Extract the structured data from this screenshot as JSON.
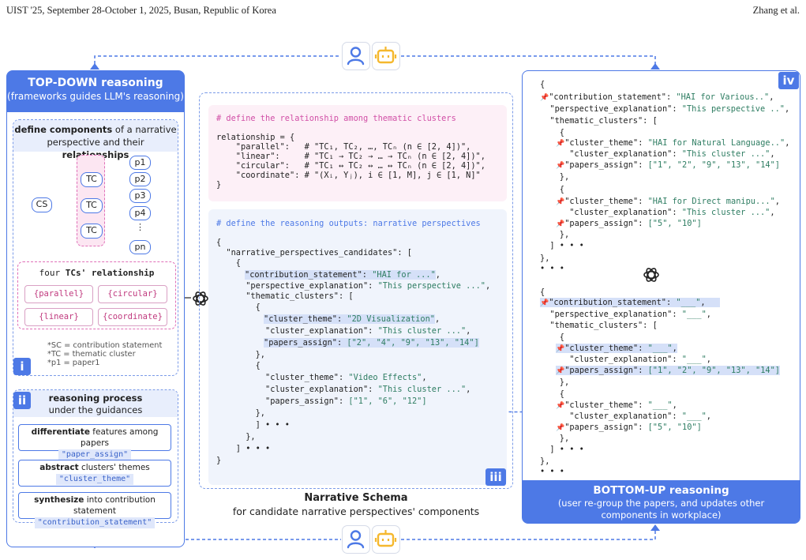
{
  "header": {
    "left": "UIST '25, September 28-October 1, 2025, Busan, Republic of Korea",
    "right": "Zhang et al."
  },
  "icons": {
    "user": "user-icon",
    "bot": "robot-icon",
    "llm": "openai-logo-icon"
  },
  "left": {
    "title": "TOP-DOWN reasoning",
    "subtitle": "(frameworks guides LLM's reasoning)",
    "components": {
      "line1_bold": "define components",
      "line1_rest": " of a narrative",
      "line2_rest": "perspective and their ",
      "line2_bold": "relationships",
      "cs": "CS",
      "tc": "TC",
      "papers": [
        "p1",
        "p2",
        "p3",
        "p4",
        "pn"
      ],
      "vdots": "⋮",
      "rel_title_prefix": "four ",
      "rel_title_bold": "TCs' relationship",
      "rel": [
        "{parallel}",
        "{circular}",
        "{linear}",
        "{coordinate}"
      ],
      "notes": [
        "*SC = contribution statement",
        "*TC = thematic cluster",
        "*p1 = paper1"
      ],
      "badge": "i"
    },
    "process": {
      "badge": "ii",
      "title_bold": "reasoning process",
      "title_rest": "under the guidances",
      "steps": [
        {
          "bold": "differentiate",
          "rest": " features among papers",
          "code": "\"paper_assign\""
        },
        {
          "bold": "abstract",
          "rest": " clusters' themes",
          "code": "\"cluster_theme\""
        },
        {
          "bold": "synthesize",
          "rest": " into contribution statement",
          "code": "\"contribution_statement\""
        }
      ]
    }
  },
  "middle": {
    "rel_comment": "# define the relationship among thematic clusters",
    "rel_code": [
      "relationship = {",
      "    \"parallel\":   # \"TC₁, TC₂, …, TCₙ (n ∈ [2, 4])\",",
      "    \"linear\":     # \"TC₁ → TC₂ → … → TCₙ (n ∈ [2, 4])\",",
      "    \"circular\":   # \"TC₁ ↔ TC₂ ↔ … ↔ TCₙ (n ∈ [2, 4])\",",
      "    \"coordinate\": # \"(Xᵢ, Yⱼ), i ∈ [1, M], j ∈ [1, N]\"",
      "}"
    ],
    "out_comment": "# define the reasoning outputs: narrative perspectives",
    "out": {
      "l1": "{",
      "l2": "  \"narrative_perspectives_candidates\": [",
      "l3": "    {",
      "cs_key": "\"contribution_statement\": ",
      "cs_val": "\"HAI for ...\"",
      "cs_end": ",",
      "pe_key": "      \"perspective_explanation\": ",
      "pe_val": "\"This perspective ...\"",
      "pe_end": ",",
      "tc_open": "      \"thematic_clusters\": [",
      "b1": "        {",
      "ct_key": "\"cluster_theme\": ",
      "ct_val": "\"2D Visualization\"",
      "ct_end": ",",
      "ce_key": "          \"cluster_explanation\": ",
      "ce_val": "\"This cluster ...\"",
      "ce_end": ",",
      "pa_key": "\"papers_assign\": ",
      "pa_val": "[\"2\", \"4\", \"9\", \"13\", \"14\"]",
      "b1c": "        },",
      "b2": "        {",
      "ct2_key": "          \"cluster_theme\": ",
      "ct2_val": "\"Video Effects\"",
      "ct2_end": ",",
      "ce2_key": "          \"cluster_explanation\": ",
      "ce2_val": "\"This cluster ...\"",
      "ce2_end": ",",
      "pa2_key": "          \"papers_assign\": ",
      "pa2_val": "[\"1\", \"6\", \"12\"]",
      "b2c": "        },",
      "dots1": "        ] • • •",
      "l_close1": "      },",
      "dots2": "    ] • • •",
      "l_close2": "}"
    },
    "badge": "iii",
    "caption_title": "Narrative Schema",
    "caption_sub": "for candidate narrative perspectives' components"
  },
  "right": {
    "badge": "iv",
    "top": {
      "l1": "{",
      "cs_key": "\"contribution_statement\": ",
      "cs_val": "\"HAI for Various..\"",
      "cs_end": ",",
      "pe_key": "  \"perspective_explanation\": ",
      "pe_val": "\"This perspective ..\"",
      "pe_end": ",",
      "tc_open": "  \"thematic_clusters\": [",
      "b1": "    {",
      "ct_key": "\"cluster_theme\": ",
      "ct_val": "\"HAI for Natural Language..\"",
      "ct_end": ",",
      "ce_key": "      \"cluster_explanation\": ",
      "ce_val": "\"This cluster ...\"",
      "ce_end": ",",
      "pa_key": "\"papers_assign\": ",
      "pa_val": "[\"1\", \"2\", \"9\", \"13\", \"14\"]",
      "b1c": "    },",
      "b2": "    {",
      "ct2_key": "\"cluster_theme\": ",
      "ct2_val": "\"HAI for Direct manipu...\"",
      "ct2_end": ",",
      "ce2_key": "      \"cluster_explanation\": ",
      "ce2_val": "\"This cluster ...\"",
      "ce2_end": ",",
      "pa2_key": "\"papers_assign\": ",
      "pa2_val": "[\"5\", \"10\"]",
      "b2c": "    },",
      "dots1": "  ] • • •",
      "close1": "},",
      "dots2": "• • •"
    },
    "bottom": {
      "l1": "{",
      "cs_key": "\"contribution_statement\": ",
      "cs_val": "\"___\"",
      "cs_end": ",",
      "pe_key": "  \"perspective_explanation\": ",
      "pe_val": "\"___\"",
      "pe_end": ",",
      "tc_open": "  \"thematic_clusters\": [",
      "b1": "    {",
      "ct_key": "\"cluster_theme\": ",
      "ct_val": "\"___\"",
      "ct_end": ",",
      "ce_key": "      \"cluster_explanation\": ",
      "ce_val": "\"___\"",
      "ce_end": ",",
      "pa_key": "\"papers_assign\": ",
      "pa_val": "[\"1\", \"2\", \"9\", \"13\", \"14\"]",
      "b1c": "    },",
      "b2": "    {",
      "ct2_key": "\"cluster_theme\": ",
      "ct2_val": "\"___\"",
      "ct2_end": ",",
      "ce2_key": "      \"cluster_explanation\": ",
      "ce2_val": "\"___\"",
      "ce2_end": ",",
      "pa2_key": "\"papers_assign\": ",
      "pa2_val": "[\"5\", \"10\"]",
      "b2c": "    },",
      "dots1": "  ] • • •",
      "close1": "},",
      "dots2": "• • •"
    },
    "title": "BOTTOM-UP reasoning",
    "subtitle_l1": "(user re-group the papers, and updates other",
    "subtitle_l2": "components in workplace)"
  },
  "colors": {
    "primary": "#4d79e6",
    "pink": "#d14fa6",
    "string": "#2e7d62",
    "highlight": "#d5e0f8",
    "bot": "#f5b82e"
  }
}
